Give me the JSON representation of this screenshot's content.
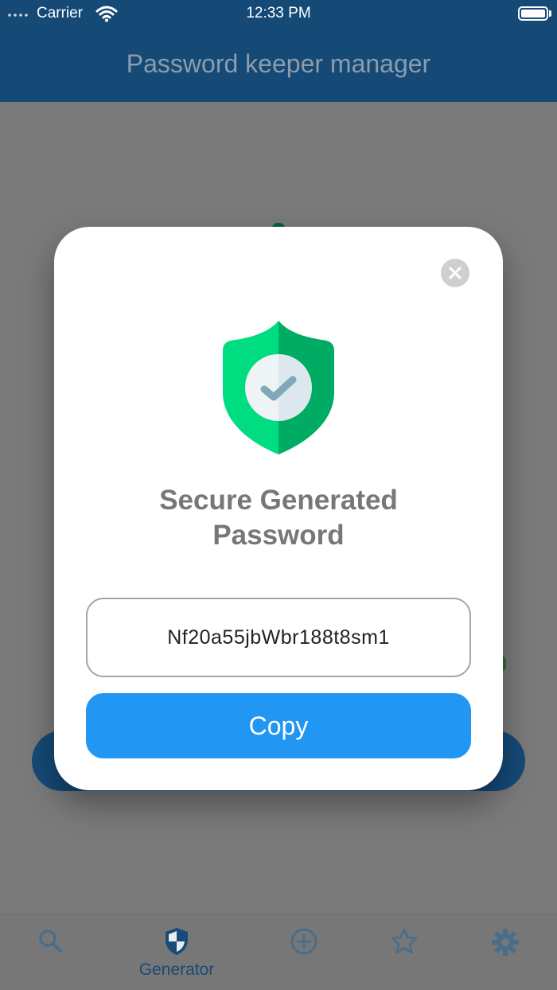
{
  "status_bar": {
    "carrier": "Carrier",
    "time": "12:33 PM"
  },
  "nav": {
    "title": "Password keeper manager"
  },
  "modal": {
    "title_line1": "Secure Generated",
    "title_line2": "Password",
    "password": "Nf20a55jbWbr188t8sm1",
    "copy_label": "Copy",
    "close_icon": "close-icon",
    "shield_icon": "shield-check-icon"
  },
  "tabs": [
    {
      "icon": "search-icon",
      "label": ""
    },
    {
      "icon": "shield-icon",
      "label": "Generator",
      "selected": true
    },
    {
      "icon": "plus-circle-icon",
      "label": ""
    },
    {
      "icon": "star-icon",
      "label": ""
    },
    {
      "icon": "gear-icon",
      "label": ""
    }
  ],
  "colors": {
    "nav_bar": "#154a77",
    "shield_light": "#00dd80",
    "shield_dark": "#00ac63",
    "copy_button": "#2196f3",
    "tab_active": "#1a4a78",
    "tab_inactive": "#4b6d8a"
  }
}
